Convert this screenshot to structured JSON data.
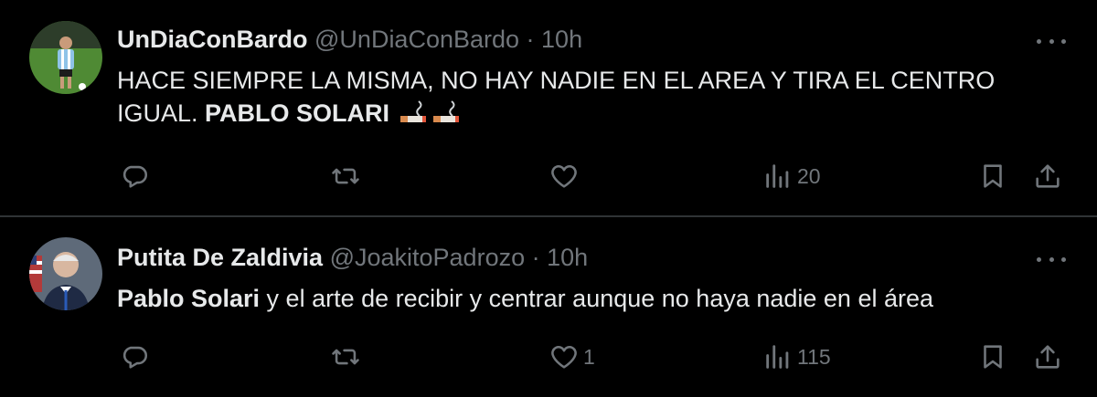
{
  "tweets": [
    {
      "display_name": "UnDiaConBardo",
      "handle": "@UnDiaConBardo",
      "separator": " · ",
      "time": "10h",
      "text_plain": "HACE SIEMPRE LA MISMA, NO HAY NADIE EN EL AREA Y TIRA EL CENTRO IGUAL. ",
      "text_bold": "PABLO SOLARI",
      "emoji": [
        "smoking-emoji",
        "smoking-emoji"
      ],
      "reply_count": "",
      "repost_count": "",
      "like_count": "",
      "views_count": "20"
    },
    {
      "display_name": "Putita De Zaldivia",
      "handle": "@JoakitoPadrozo",
      "separator": " · ",
      "time": "10h",
      "text_bold": "Pablo Solari",
      "text_plain": " y el arte de recibir y centrar aunque no haya nadie en el área",
      "reply_count": "",
      "repost_count": "",
      "like_count": "1",
      "views_count": "115"
    }
  ],
  "colors": {
    "background": "#000000",
    "text_primary": "#e7e9ea",
    "text_secondary": "#71767b",
    "divider": "#2f3336"
  },
  "icons": [
    "reply-icon",
    "repost-icon",
    "like-icon",
    "views-icon",
    "bookmark-icon",
    "share-icon",
    "more-icon"
  ]
}
